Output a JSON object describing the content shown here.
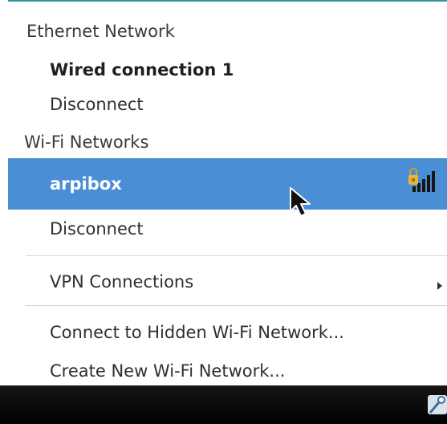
{
  "menu": {
    "ethernet_header": "Ethernet Network",
    "wired_connection_label": "Wired connection 1",
    "ethernet_disconnect_label": "Disconnect",
    "wifi_header": "Wi-Fi Networks",
    "selected_network_label": "arpibox",
    "wifi_disconnect_label": "Disconnect",
    "vpn_label": "VPN Connections",
    "hidden_network_label": "Connect to Hidden Wi-Fi Network...",
    "create_network_label": "Create New Wi-Fi Network..."
  },
  "icons": {
    "wifi_signal": "locked-wifi-signal-icon",
    "submenu": "chevron-right-icon",
    "cursor": "mouse-cursor-icon",
    "taskbar": "network-tray-icon"
  },
  "colors": {
    "selected_background": "#4a8fd5",
    "accent_border": "#2b9aa3",
    "taskbar_background": "#000000"
  }
}
